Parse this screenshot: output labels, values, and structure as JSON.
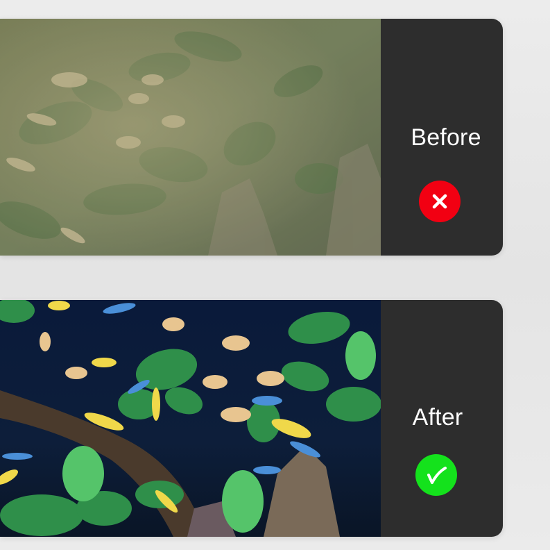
{
  "before": {
    "label": "Before",
    "status_icon": "cross-icon",
    "status_color": "#f20012",
    "photo_description_color": "#5a6a48"
  },
  "after": {
    "label": "After",
    "status_icon": "check-icon",
    "status_color": "#14e21c",
    "photo_description_color": "#0c1a36"
  }
}
